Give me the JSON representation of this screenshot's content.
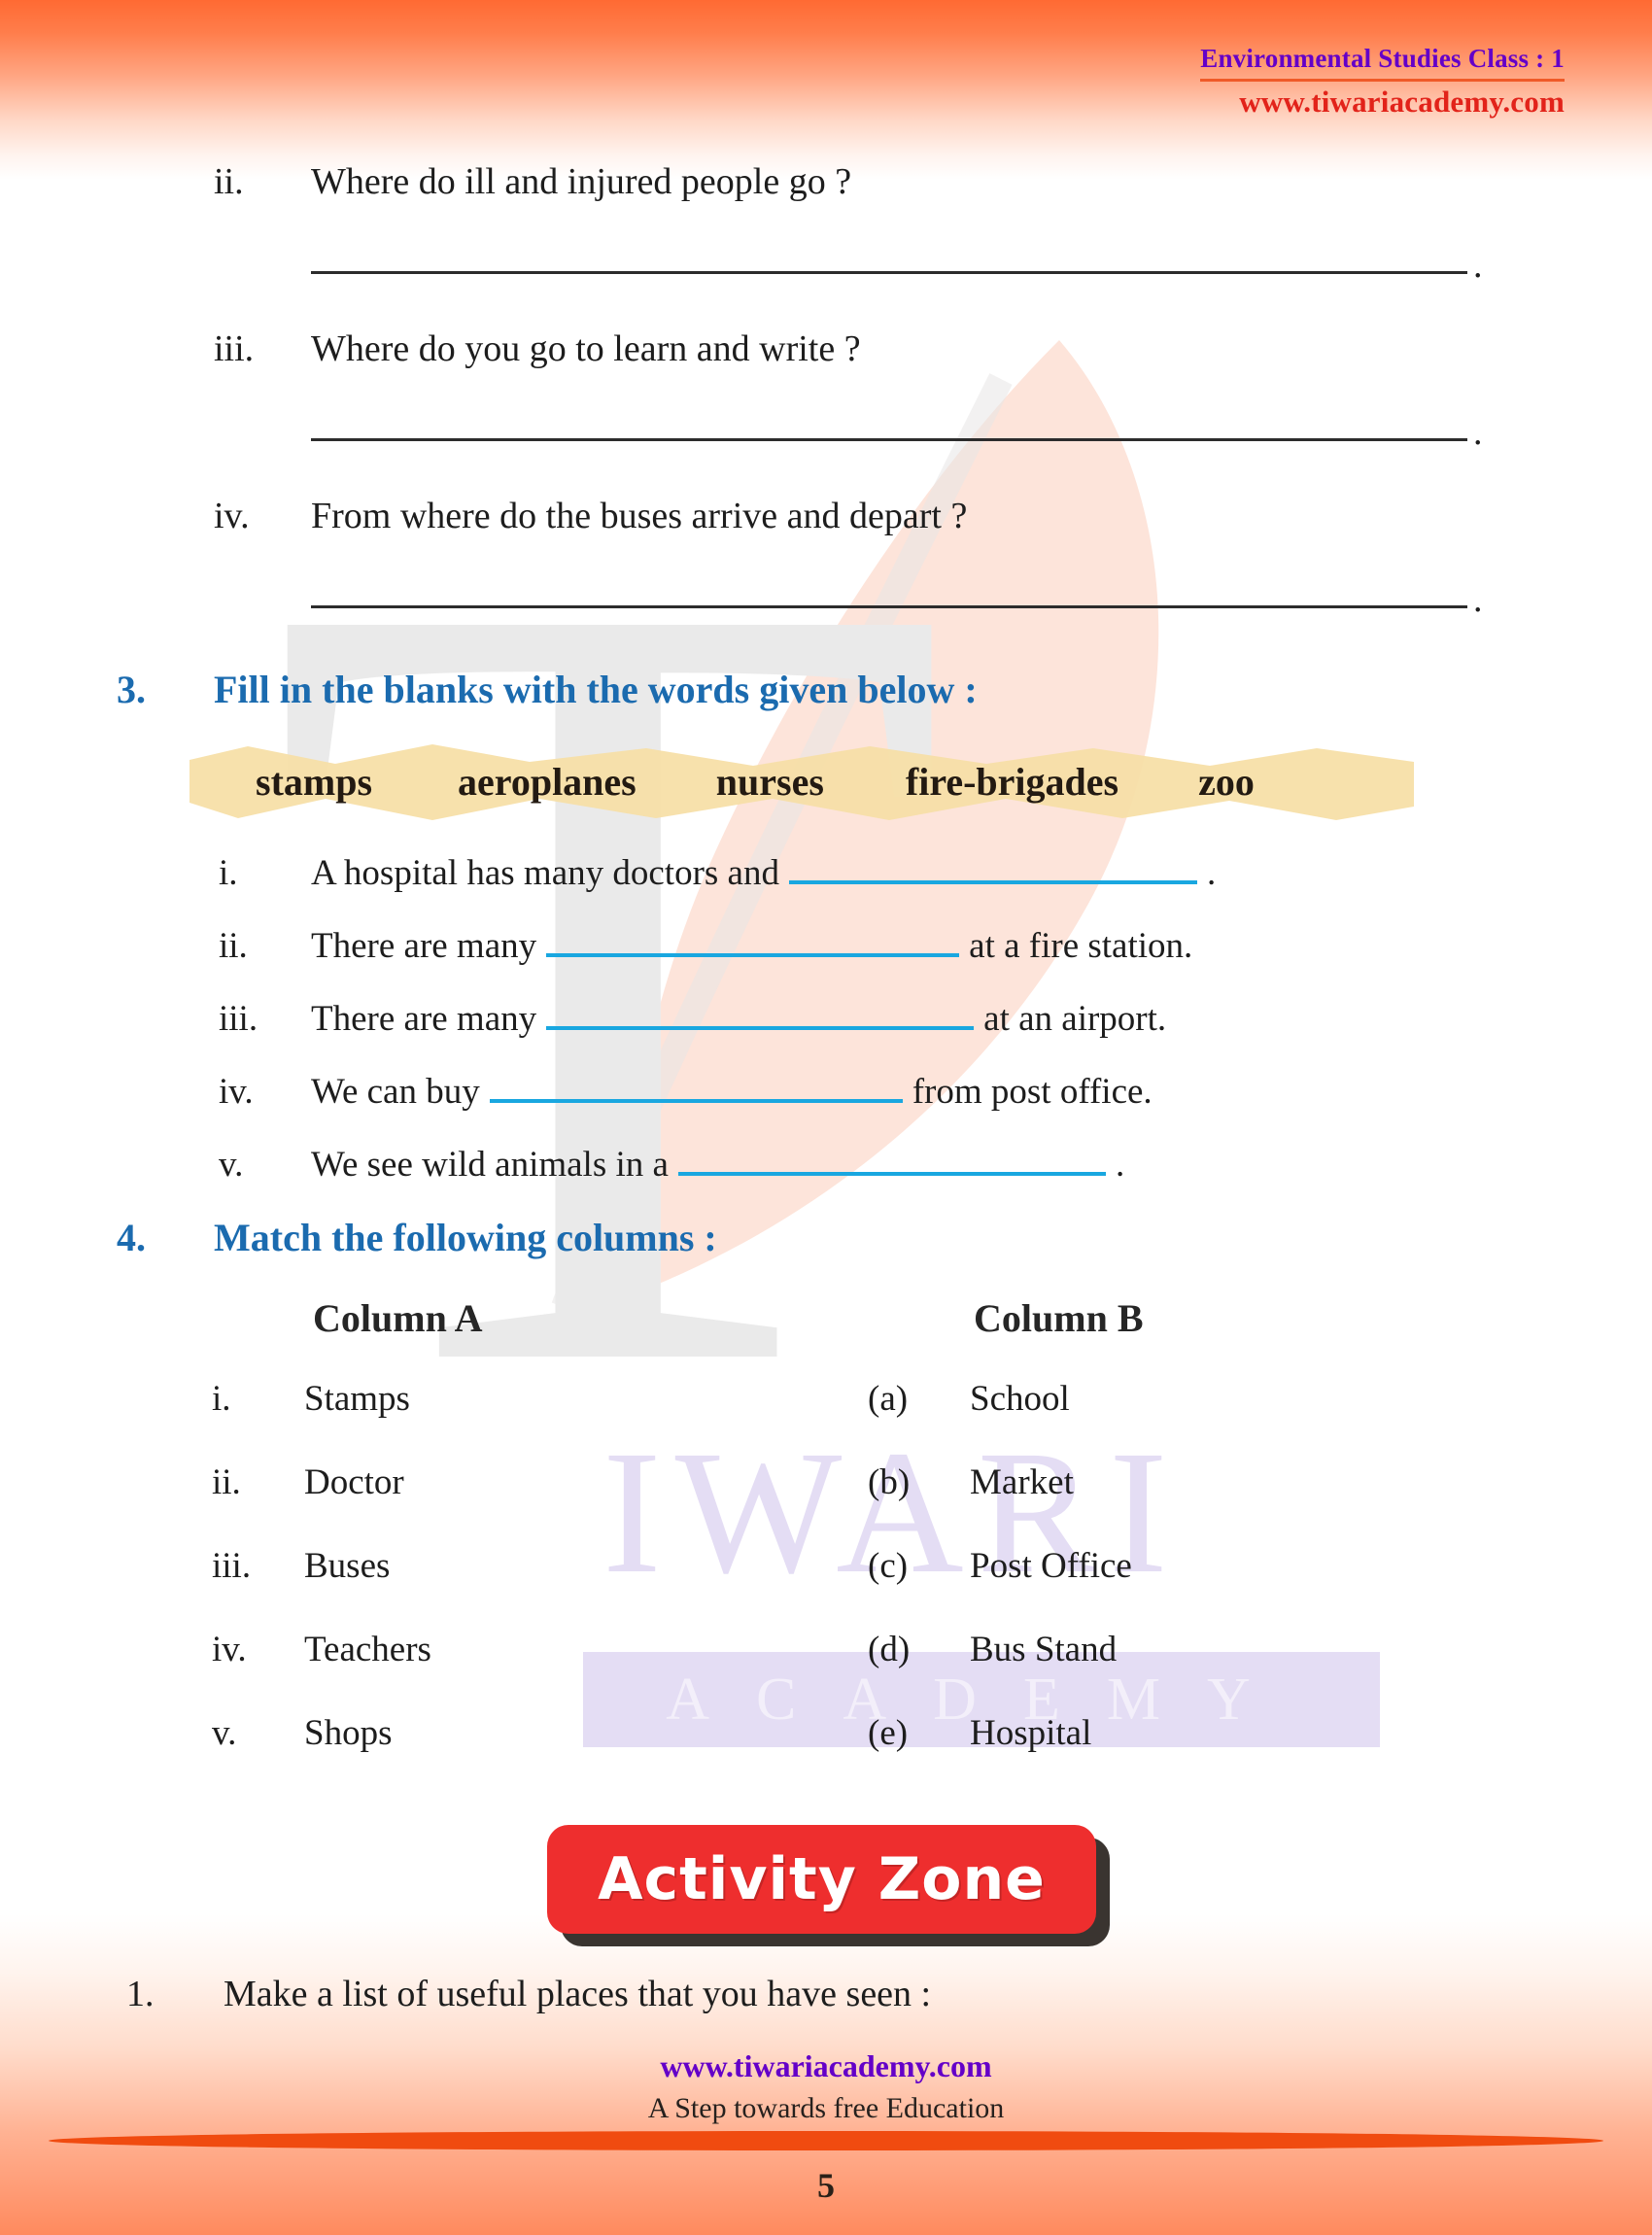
{
  "header": {
    "class_title": "Environmental Studies Class : 1",
    "website": "www.tiwariacademy.com",
    "title_color": "#6400C8",
    "website_color": "#E2231A"
  },
  "watermark": {
    "letter": "T",
    "brand_line1": "IWARI",
    "brand_line2": "ACADEMY",
    "color": "#E4DDF4",
    "gray_color": "#EAEAEA"
  },
  "carryover_questions": [
    {
      "num": "ii.",
      "text": "Where do ill and injured people go ?",
      "end_dot": "."
    },
    {
      "num": "iii.",
      "text": "Where do you go to learn and write ?",
      "end_dot": "."
    },
    {
      "num": "iv.",
      "text": "From where do the buses arrive and depart ?",
      "end_dot": "."
    }
  ],
  "section3": {
    "number": "3.",
    "title": "Fill in the blanks with the words given below :",
    "heading_color": "#1B6BAF",
    "word_bank": [
      "stamps",
      "aeroplanes",
      "nurses",
      "fire-brigades",
      "zoo"
    ],
    "word_bank_highlight_color": "#F6DFA6",
    "blank_color": "#19A7E0",
    "items": [
      {
        "num": "i.",
        "before": "A hospital has many doctors and",
        "after": "."
      },
      {
        "num": "ii.",
        "before": "There are many",
        "after": "at a fire station."
      },
      {
        "num": "iii.",
        "before": "There are many",
        "after": "at an airport."
      },
      {
        "num": "iv.",
        "before": "We can buy",
        "after": "from post office."
      },
      {
        "num": "v.",
        "before": "We see wild animals in a",
        "after": "."
      }
    ]
  },
  "section4": {
    "number": "4.",
    "title": "Match the following columns :",
    "column_a_header": "Column A",
    "column_b_header": "Column B",
    "column_a": [
      {
        "num": "i.",
        "text": "Stamps"
      },
      {
        "num": "ii.",
        "text": "Doctor"
      },
      {
        "num": "iii.",
        "text": "Buses"
      },
      {
        "num": "iv.",
        "text": "Teachers"
      },
      {
        "num": "v.",
        "text": "Shops"
      }
    ],
    "column_b": [
      {
        "letter": "(a)",
        "text": "School"
      },
      {
        "letter": "(b)",
        "text": "Market"
      },
      {
        "letter": "(c)",
        "text": "Post Office"
      },
      {
        "letter": "(d)",
        "text": "Bus Stand"
      },
      {
        "letter": "(e)",
        "text": "Hospital"
      }
    ]
  },
  "activity_zone": {
    "badge_label": "Activity Zone",
    "badge_color": "#EE2E2E",
    "badge_text_color": "#FFFFFF",
    "items": [
      {
        "num": "1.",
        "text": "Make a list of useful places that you have seen :"
      }
    ]
  },
  "footer": {
    "website": "www.tiwariacademy.com",
    "tagline": "A Step towards free Education",
    "page_number": "5",
    "website_color": "#6400C8",
    "divider_color": "#F04B10"
  }
}
